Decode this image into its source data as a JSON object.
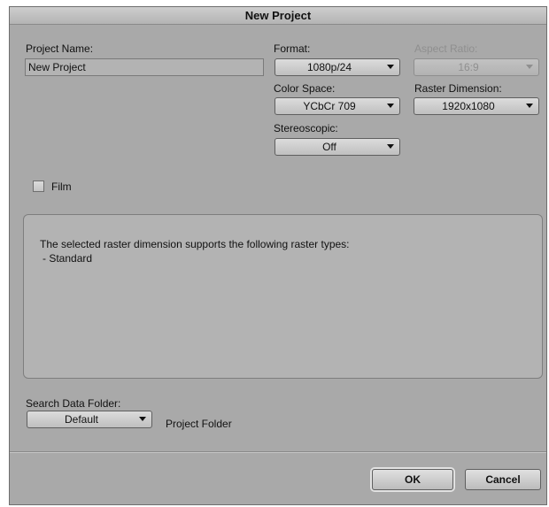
{
  "dialog": {
    "title": "New Project"
  },
  "project_name": {
    "label": "Project Name:",
    "value": "New Project"
  },
  "format": {
    "label": "Format:",
    "value": "1080p/24"
  },
  "aspect_ratio": {
    "label": "Aspect Ratio:",
    "value": "16:9",
    "enabled": false
  },
  "color_space": {
    "label": "Color Space:",
    "value": "YCbCr 709"
  },
  "raster_dimension": {
    "label": "Raster Dimension:",
    "value": "1920x1080"
  },
  "stereoscopic": {
    "label": "Stereoscopic:",
    "value": "Off"
  },
  "film": {
    "label": "Film",
    "checked": false
  },
  "info": {
    "line1": "The selected raster dimension supports the following raster types:",
    "line2": "- Standard"
  },
  "search_data_folder": {
    "label": "Search Data Folder:",
    "value": "Default",
    "path_label": "Project Folder"
  },
  "buttons": {
    "ok": "OK",
    "cancel": "Cancel"
  }
}
